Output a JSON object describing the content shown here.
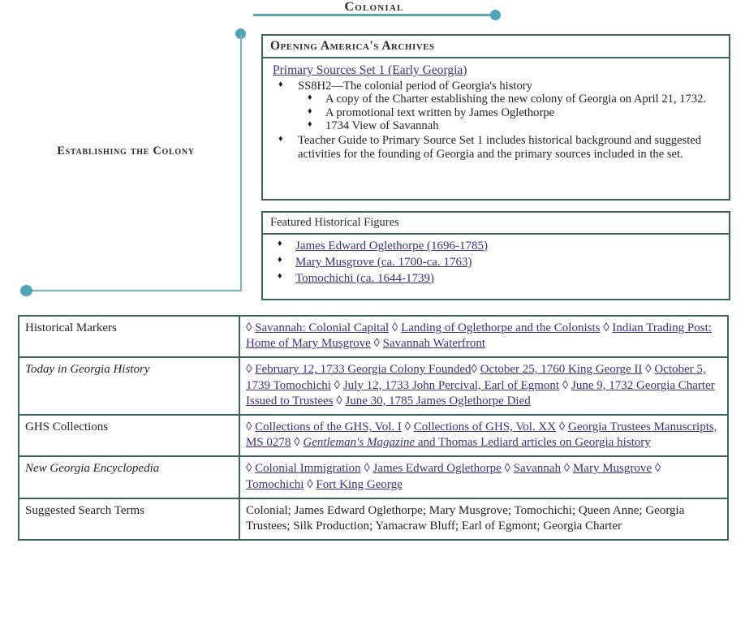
{
  "top": {
    "title": "Colonial",
    "dot_color": "#4ea5b8",
    "rule_color": "#5aa7b5"
  },
  "branch": {
    "label": "Establishing the Colony",
    "line_color": "#74b6c2",
    "dot_color": "#4ea5b8"
  },
  "panels": {
    "archives": {
      "header": "Opening America's Archives",
      "subhead_link": "Primary Sources Set 1 (Early Georgia)",
      "bullets": [
        {
          "text": "SS8H2—The colonial period of Georgia's history",
          "children": [
            "A copy of the Charter establishing the new colony of Georgia on April 21, 1732.",
            "A promotional text written by James Oglethorpe",
            "1734 View of Savannah"
          ]
        },
        {
          "text": "Teacher Guide to Primary Source Set 1 includes historical background and suggested activities for the founding of  Georgia and the primary sources included in the set.",
          "children": []
        }
      ]
    },
    "figures": {
      "header": "Featured Historical Figures",
      "items": [
        "James Edward Oglethorpe  (1696-1785)",
        "Mary Musgrove (ca. 1700-ca. 1763)",
        "Tomochichi (ca. 1644-1739)"
      ]
    }
  },
  "table": {
    "rows": [
      {
        "label": "Historical Markers",
        "label_italic": false,
        "links": [
          "Savannah: Colonial Capital",
          "Landing of Oglethorpe and the Colonists",
          "Indian Trading Post: Home of Mary Musgrove",
          "Savannah Waterfront"
        ],
        "plain_text": ""
      },
      {
        "label": "Today in Georgia History",
        "label_italic": true,
        "links": [
          "February 12, 1733 Georgia Colony Founded",
          "October 25, 1760 King George II",
          "October 5, 1739  Tomochichi",
          "July 12, 1733 John Percival, Earl of Egmont",
          "June 9, 1732 Georgia Charter Issued to Trustees",
          "June 30, 1785  James Oglethorpe Died"
        ],
        "plain_text": ""
      },
      {
        "label": "GHS Collections",
        "label_italic": false,
        "links": [
          "Collections of the GHS, Vol. I",
          "Collections of GHS, Vol. XX",
          "Georgia Trustees Manuscripts, MS 0278",
          "Gentleman's Magazine and Thomas Lediard articles on Georgia history"
        ],
        "plain_text": ""
      },
      {
        "label": "New Georgia Encyclopedia",
        "label_italic": true,
        "links": [
          "Colonial Immigration",
          "James Edward Oglethorpe",
          "Savannah",
          "Mary Musgrove",
          "Tomochichi",
          "Fort King George"
        ],
        "plain_text": ""
      },
      {
        "label": "Suggested Search Terms",
        "label_italic": false,
        "links": [],
        "plain_text": "Colonial; James Edward Oglethorpe; Mary Musgrove; Tomochichi; Queen Anne; Georgia Trustees; Silk Production; Yamacraw Bluff; Earl of Egmont; Georgia Charter"
      }
    ],
    "diamond_glyph": "◊",
    "link_color": "#33337f",
    "border_color": "#3b6360"
  },
  "icons": {
    "bullet": "♦",
    "diamond": "◊"
  }
}
